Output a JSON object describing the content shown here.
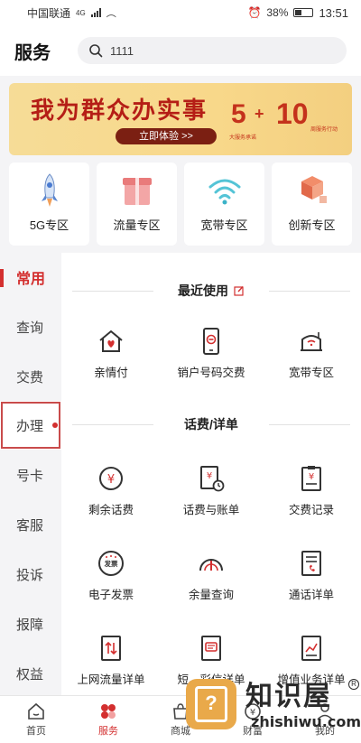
{
  "status_bar": {
    "carrier": "中国联通",
    "network": "4G",
    "battery": "38%",
    "time": "13:51"
  },
  "header": {
    "title": "服务",
    "search_value": "1111"
  },
  "banner": {
    "title": "我为群众办实事",
    "button": "立即体验 >>",
    "num_left": "5",
    "plus": "+",
    "num_right": "10",
    "sub_left": "大服务承诺",
    "sub_right": "周服务行动"
  },
  "zones": [
    {
      "label": "5G专区",
      "icon": "rocket-icon"
    },
    {
      "label": "流量专区",
      "icon": "gift-box-icon"
    },
    {
      "label": "宽带专区",
      "icon": "wifi-icon"
    },
    {
      "label": "创新专区",
      "icon": "blocks-icon"
    }
  ],
  "sidebar": {
    "items": [
      {
        "label": "常用"
      },
      {
        "label": "查询"
      },
      {
        "label": "交费"
      },
      {
        "label": "办理"
      },
      {
        "label": "号卡"
      },
      {
        "label": "客服"
      },
      {
        "label": "投诉"
      },
      {
        "label": "报障"
      },
      {
        "label": "权益"
      }
    ]
  },
  "sections": {
    "recent": {
      "title": "最近使用",
      "items": [
        {
          "label": "亲情付",
          "icon": "home-heart-icon"
        },
        {
          "label": "销户号码交费",
          "icon": "phone-minus-icon"
        },
        {
          "label": "宽带专区",
          "icon": "router-icon"
        }
      ]
    },
    "billing": {
      "title": "话费/详单",
      "items": [
        {
          "label": "剩余话费",
          "icon": "yuan-coin-icon"
        },
        {
          "label": "话费与账单",
          "icon": "bill-clock-icon"
        },
        {
          "label": "交费记录",
          "icon": "clipboard-yuan-icon"
        },
        {
          "label": "电子发票",
          "icon": "invoice-icon",
          "badge": "发票"
        },
        {
          "label": "余量查询",
          "icon": "gauge-icon"
        },
        {
          "label": "通话详单",
          "icon": "call-list-icon"
        },
        {
          "label": "上网流量详单",
          "icon": "data-list-icon"
        },
        {
          "label": "短、彩信详单",
          "icon": "message-list-icon"
        },
        {
          "label": "增值业务详单",
          "icon": "chart-list-icon"
        }
      ]
    }
  },
  "tabbar": {
    "items": [
      {
        "label": "首页",
        "icon": "home-icon"
      },
      {
        "label": "服务",
        "icon": "service-icon"
      },
      {
        "label": "商城",
        "icon": "shop-icon"
      },
      {
        "label": "财富",
        "icon": "wealth-icon"
      },
      {
        "label": "我的",
        "icon": "user-icon"
      }
    ]
  },
  "watermark": {
    "brand": "知识屋",
    "url": "zhishiwu.com",
    "reg": "R",
    "q": "?"
  },
  "colors": {
    "accent": "#d32f2f",
    "banner_bg": "#f6dc97",
    "banner_text": "#b51e16"
  }
}
